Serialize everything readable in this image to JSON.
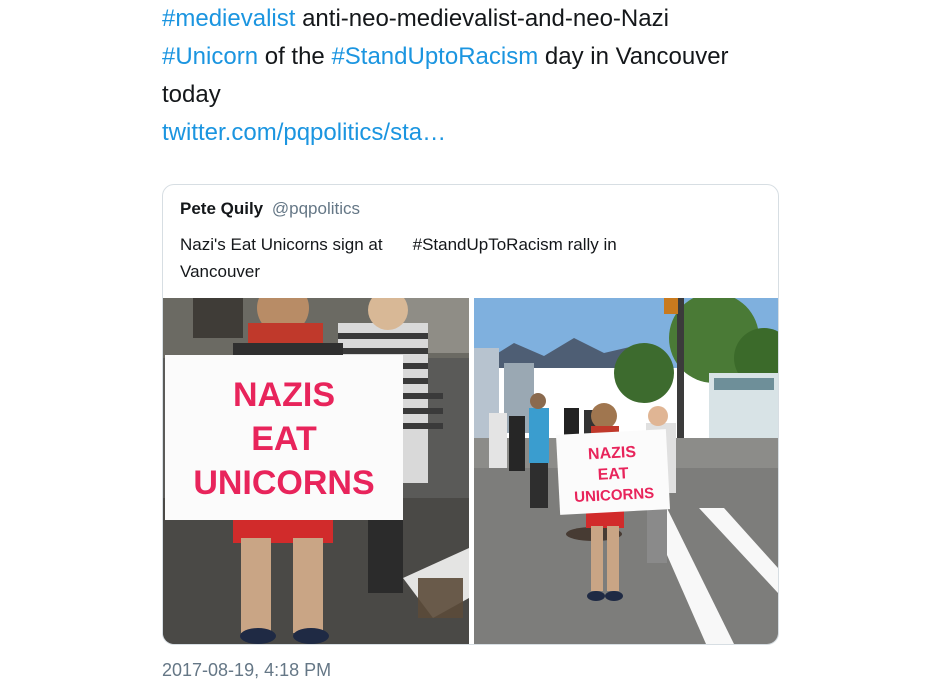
{
  "tweet": {
    "line1": {
      "hashtag": "#medievalist",
      "text": " anti-neo-medievalist-and-neo-Nazi"
    },
    "line2": {
      "hashtag1": "#Unicorn",
      "mid": " of the ",
      "hashtag2": "#StandUptoRacism",
      "text": " day in Vancouver"
    },
    "line3": "today",
    "link": "twitter.com/pqpolitics/sta…"
  },
  "quote": {
    "name": "Pete Quily",
    "handle": "@pqpolitics",
    "line1_text": "Nazi's Eat Unicorns sign at",
    "line1_hashtag": "#StandUpToRacism",
    "line1_rest": " rally in",
    "line2": "Vancouver"
  },
  "sign": {
    "line1": "NAZIS",
    "line2": "EAT",
    "line3": "UNICORNS"
  },
  "timestamp": "2017-08-19, 4:18 PM",
  "colors": {
    "link": "#1b95e0",
    "sign_text": "#e8245b",
    "muted": "#657786"
  }
}
